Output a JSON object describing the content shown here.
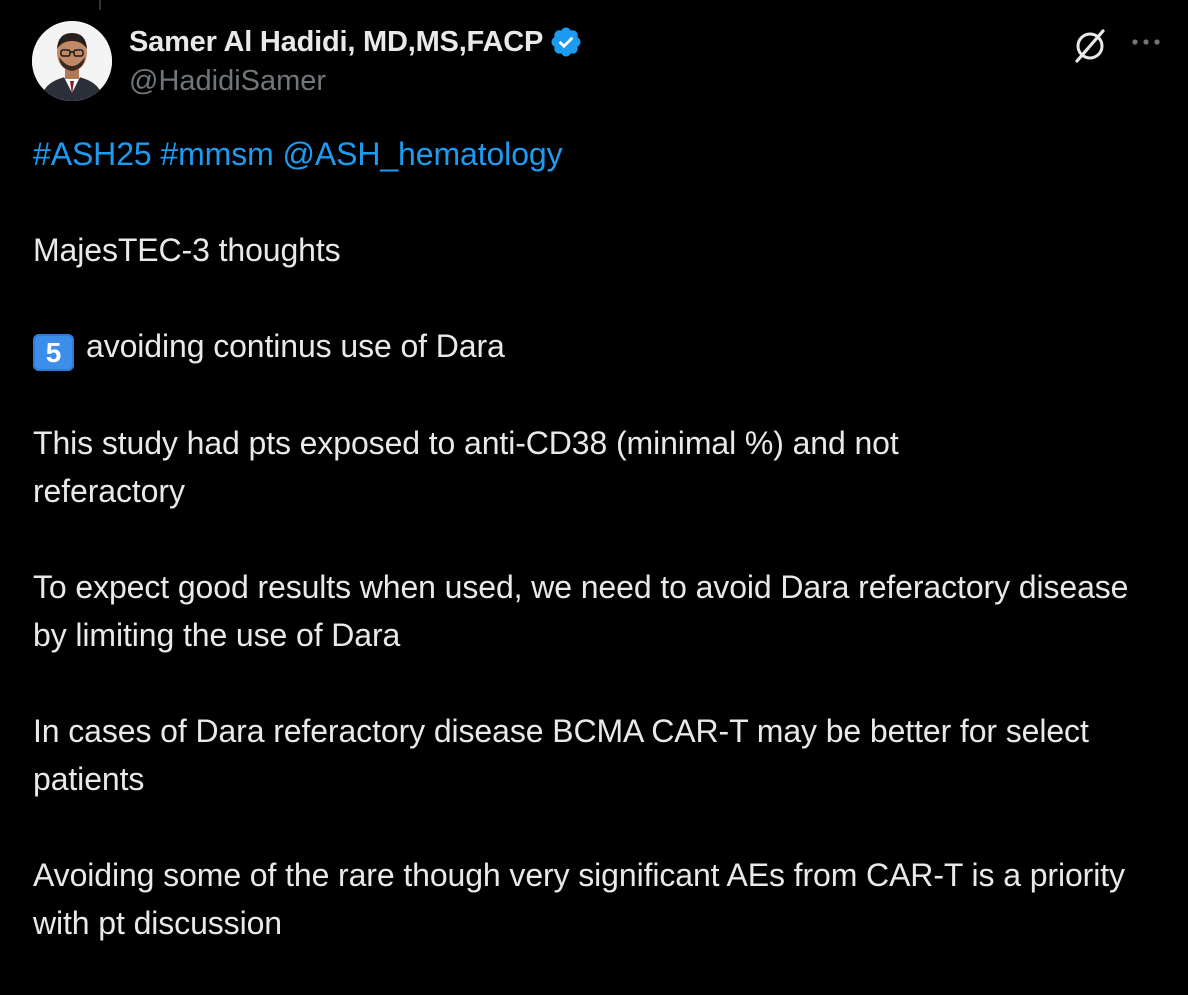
{
  "author": {
    "display_name": "Samer Al Hadidi, MD,MS,FACP",
    "handle": "@HadidiSamer",
    "verified": true
  },
  "header_icons": [
    "grok-icon",
    "more-icon"
  ],
  "tweet": {
    "tags": [
      "#ASH25",
      "#mmsm",
      "@ASH_hematology"
    ],
    "paragraphs": {
      "p1": "MajesTEC-3 thoughts",
      "p2_keycap": "5",
      "p2": "avoiding continus use of Dara",
      "p3": "This study had pts exposed to anti-CD38 (minimal %) and not referactory",
      "p4": "To expect good results when used, we need to avoid Dara referactory disease by limiting the use of Dara",
      "p5": "In cases of Dara referactory disease BCMA CAR-T may be better for select patients",
      "p6": "Avoiding some of the rare though very significant AEs from CAR-T is a priority with pt discussion"
    }
  },
  "colors": {
    "background": "#000000",
    "text": "#e7e9ea",
    "secondary": "#71767b",
    "link": "#1d9bf0"
  }
}
